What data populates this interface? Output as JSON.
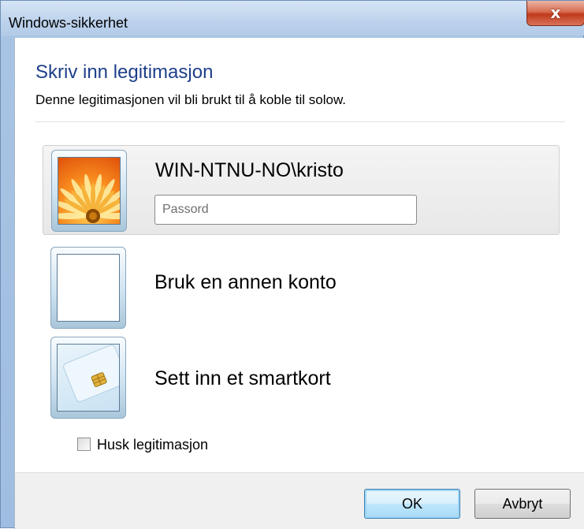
{
  "window": {
    "title": "Windows-sikkerhet",
    "close_glyph": "x"
  },
  "content": {
    "heading": "Skriv inn legitimasjon",
    "subheading": "Denne legitimasjonen vil bli brukt til å koble til solow."
  },
  "accounts": [
    {
      "label": "WIN-NTNU-NO\\kristo",
      "icon": "user-flower-picture-icon",
      "selected": true,
      "password": {
        "value": "",
        "placeholder": "Passord"
      }
    },
    {
      "label": "Bruk en annen konto",
      "icon": "blank-user-tile-icon",
      "selected": false
    },
    {
      "label": "Sett inn et smartkort",
      "icon": "smartcard-icon",
      "selected": false
    }
  ],
  "remember": {
    "label": "Husk legitimasjon",
    "checked": false
  },
  "buttons": {
    "ok": "OK",
    "cancel": "Avbryt"
  },
  "colors": {
    "heading": "#1e3f8a",
    "titlebar": "#bcd2ec",
    "close_button": "#c0391c",
    "default_button_border": "#3c7fb1"
  }
}
